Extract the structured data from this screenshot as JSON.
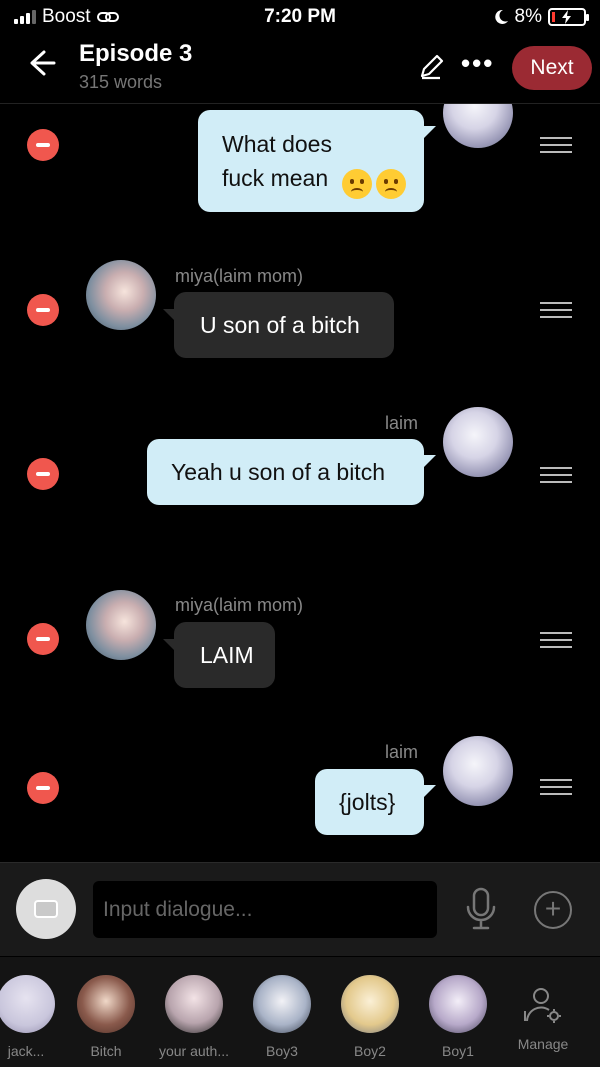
{
  "status_bar": {
    "carrier": "Boost",
    "time": "7:20 PM",
    "battery": "8%"
  },
  "header": {
    "title": "Episode 3",
    "subtitle": "315 words",
    "next_label": "Next"
  },
  "messages": [
    {
      "side": "me",
      "name": "",
      "text": "What does fuck mean",
      "emoji_count": 2
    },
    {
      "side": "them",
      "name": "miya(laim mom)",
      "text": "U son of a bitch"
    },
    {
      "side": "me",
      "name": "laim",
      "text": "Yeah u son of a bitch"
    },
    {
      "side": "them",
      "name": "miya(laim mom)",
      "text": "LAIM"
    },
    {
      "side": "me",
      "name": "laim",
      "text": "{jolts}"
    }
  ],
  "input": {
    "placeholder": "Input dialogue..."
  },
  "characters": [
    {
      "label": "jack...",
      "color": "#c9c6dc"
    },
    {
      "label": "Bitch",
      "color": "#8a5a4c"
    },
    {
      "label": "your auth...",
      "color": "#b8a4ad"
    },
    {
      "label": "Boy3",
      "color": "#a9b3c7"
    },
    {
      "label": "Boy2",
      "color": "#e3c98c"
    },
    {
      "label": "Boy1",
      "color": "#b7a9c9"
    }
  ],
  "manage_label": "Manage",
  "colors": {
    "accent": "#9b2a33",
    "delete": "#f0574e",
    "my_bubble": "#d1edf7",
    "their_bubble": "#2a2a2a"
  }
}
